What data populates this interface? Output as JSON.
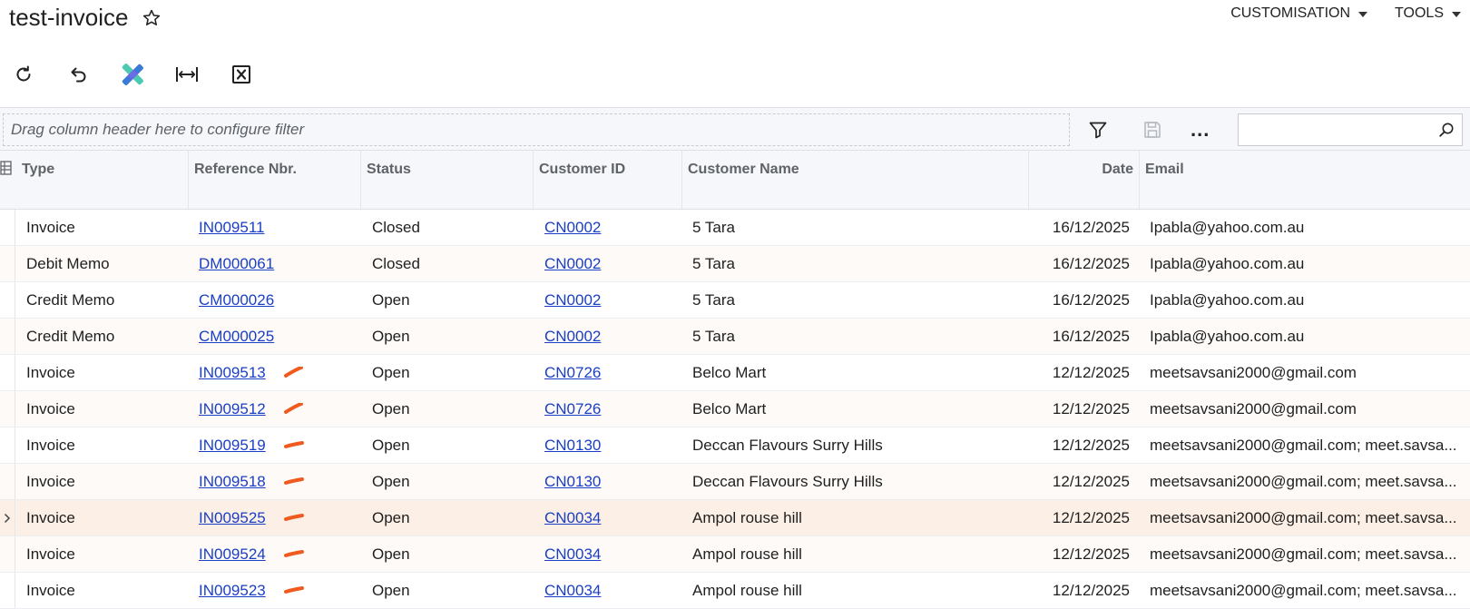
{
  "page": {
    "title": "test-invoice"
  },
  "top_menu": [
    {
      "label": "CUSTOMISATION"
    },
    {
      "label": "TOOLS"
    }
  ],
  "toolbar": {
    "buttons": [
      "refresh-icon",
      "undo-icon",
      "puzzle-icon",
      "fit-width-icon",
      "excel-export-icon"
    ]
  },
  "filter": {
    "drop_hint": "Drag column header here to configure filter",
    "search_value": "",
    "more_label": "..."
  },
  "grid": {
    "columns": [
      "Type",
      "Reference Nbr.",
      "Status",
      "Customer ID",
      "Customer Name",
      "Date",
      "Email"
    ],
    "rows": [
      {
        "type": "Invoice",
        "ref": "IN009511",
        "status": "Closed",
        "customer_id": "CN0002",
        "customer_name": "5 Tara",
        "date": "16/12/2025",
        "email": "Ipabla@yahoo.com.au"
      },
      {
        "type": "Debit Memo",
        "ref": "DM000061",
        "status": "Closed",
        "customer_id": "CN0002",
        "customer_name": "5 Tara",
        "date": "16/12/2025",
        "email": "Ipabla@yahoo.com.au"
      },
      {
        "type": "Credit Memo",
        "ref": "CM000026",
        "status": "Open",
        "customer_id": "CN0002",
        "customer_name": "5 Tara",
        "date": "16/12/2025",
        "email": "Ipabla@yahoo.com.au"
      },
      {
        "type": "Credit Memo",
        "ref": "CM000025",
        "status": "Open",
        "customer_id": "CN0002",
        "customer_name": "5 Tara",
        "date": "16/12/2025",
        "email": "Ipabla@yahoo.com.au"
      },
      {
        "type": "Invoice",
        "ref": "IN009513",
        "status": "Open",
        "customer_id": "CN0726",
        "customer_name": "Belco Mart",
        "date": "12/12/2025",
        "email": "meetsavsani2000@gmail.com"
      },
      {
        "type": "Invoice",
        "ref": "IN009512",
        "status": "Open",
        "customer_id": "CN0726",
        "customer_name": "Belco Mart",
        "date": "12/12/2025",
        "email": "meetsavsani2000@gmail.com"
      },
      {
        "type": "Invoice",
        "ref": "IN009519",
        "status": "Open",
        "customer_id": "CN0130",
        "customer_name": "Deccan Flavours Surry Hills",
        "date": "12/12/2025",
        "email": "meetsavsani2000@gmail.com; meet.savsa..."
      },
      {
        "type": "Invoice",
        "ref": "IN009518",
        "status": "Open",
        "customer_id": "CN0130",
        "customer_name": "Deccan Flavours Surry Hills",
        "date": "12/12/2025",
        "email": "meetsavsani2000@gmail.com; meet.savsa..."
      },
      {
        "type": "Invoice",
        "ref": "IN009525",
        "status": "Open",
        "customer_id": "CN0034",
        "customer_name": "Ampol rouse hill",
        "date": "12/12/2025",
        "email": "meetsavsani2000@gmail.com; meet.savsa..."
      },
      {
        "type": "Invoice",
        "ref": "IN009524",
        "status": "Open",
        "customer_id": "CN0034",
        "customer_name": "Ampol rouse hill",
        "date": "12/12/2025",
        "email": "meetsavsani2000@gmail.com; meet.savsa..."
      },
      {
        "type": "Invoice",
        "ref": "IN009523",
        "status": "Open",
        "customer_id": "CN0034",
        "customer_name": "Ampol rouse hill",
        "date": "12/12/2025",
        "email": "meetsavsani2000@gmail.com; meet.savsa..."
      }
    ],
    "selected_row": 8,
    "marked_rows": [
      4,
      5,
      6,
      7,
      8,
      9,
      10
    ]
  },
  "colors": {
    "link": "#1a3fc4",
    "mark": "#f05a1e",
    "selected_row": "#fcefe6",
    "header_bg": "#f5f7fa"
  }
}
